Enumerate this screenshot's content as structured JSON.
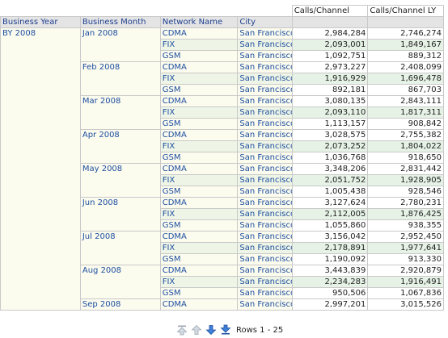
{
  "columns": {
    "business_year": "Business Year",
    "business_month": "Business Month",
    "network_name": "Network Name",
    "city": "City",
    "calls_channel": "Calls/Channel",
    "calls_channel_ly": "Calls/Channel LY"
  },
  "year": "BY 2008",
  "months": [
    {
      "label": "Jan 2008",
      "rows": [
        {
          "network": "CDMA",
          "city": "San Francisco",
          "calls": "2,984,284",
          "calls_ly": "2,746,274"
        },
        {
          "network": "FIX",
          "city": "San Francisco",
          "calls": "2,093,001",
          "calls_ly": "1,849,167"
        },
        {
          "network": "GSM",
          "city": "San Francisco",
          "calls": "1,092,751",
          "calls_ly": "889,312"
        }
      ]
    },
    {
      "label": "Feb 2008",
      "rows": [
        {
          "network": "CDMA",
          "city": "San Francisco",
          "calls": "2,973,227",
          "calls_ly": "2,408,099"
        },
        {
          "network": "FIX",
          "city": "San Francisco",
          "calls": "1,916,929",
          "calls_ly": "1,696,478"
        },
        {
          "network": "GSM",
          "city": "San Francisco",
          "calls": "892,181",
          "calls_ly": "867,703"
        }
      ]
    },
    {
      "label": "Mar 2008",
      "rows": [
        {
          "network": "CDMA",
          "city": "San Francisco",
          "calls": "3,080,135",
          "calls_ly": "2,843,111"
        },
        {
          "network": "FIX",
          "city": "San Francisco",
          "calls": "2,093,110",
          "calls_ly": "1,817,311"
        },
        {
          "network": "GSM",
          "city": "San Francisco",
          "calls": "1,113,157",
          "calls_ly": "908,842"
        }
      ]
    },
    {
      "label": "Apr 2008",
      "rows": [
        {
          "network": "CDMA",
          "city": "San Francisco",
          "calls": "3,028,575",
          "calls_ly": "2,755,382"
        },
        {
          "network": "FIX",
          "city": "San Francisco",
          "calls": "2,073,252",
          "calls_ly": "1,804,022"
        },
        {
          "network": "GSM",
          "city": "San Francisco",
          "calls": "1,036,768",
          "calls_ly": "918,650"
        }
      ]
    },
    {
      "label": "May 2008",
      "rows": [
        {
          "network": "CDMA",
          "city": "San Francisco",
          "calls": "3,348,206",
          "calls_ly": "2,831,442"
        },
        {
          "network": "FIX",
          "city": "San Francisco",
          "calls": "2,051,752",
          "calls_ly": "1,928,905"
        },
        {
          "network": "GSM",
          "city": "San Francisco",
          "calls": "1,005,438",
          "calls_ly": "928,546"
        }
      ]
    },
    {
      "label": "Jun 2008",
      "rows": [
        {
          "network": "CDMA",
          "city": "San Francisco",
          "calls": "3,127,624",
          "calls_ly": "2,780,231"
        },
        {
          "network": "FIX",
          "city": "San Francisco",
          "calls": "2,112,005",
          "calls_ly": "1,876,425"
        },
        {
          "network": "GSM",
          "city": "San Francisco",
          "calls": "1,055,860",
          "calls_ly": "938,355"
        }
      ]
    },
    {
      "label": "Jul 2008",
      "rows": [
        {
          "network": "CDMA",
          "city": "San Francisco",
          "calls": "3,156,042",
          "calls_ly": "2,952,450"
        },
        {
          "network": "FIX",
          "city": "San Francisco",
          "calls": "2,178,891",
          "calls_ly": "1,977,641"
        },
        {
          "network": "GSM",
          "city": "San Francisco",
          "calls": "1,190,092",
          "calls_ly": "913,330"
        }
      ]
    },
    {
      "label": "Aug 2008",
      "rows": [
        {
          "network": "CDMA",
          "city": "San Francisco",
          "calls": "3,443,839",
          "calls_ly": "2,920,879"
        },
        {
          "network": "FIX",
          "city": "San Francisco",
          "calls": "2,234,283",
          "calls_ly": "1,916,491"
        },
        {
          "network": "GSM",
          "city": "San Francisco",
          "calls": "950,506",
          "calls_ly": "1,067,836"
        }
      ]
    },
    {
      "label": "Sep 2008",
      "rows": [
        {
          "network": "CDMA",
          "city": "San Francisco",
          "calls": "2,997,201",
          "calls_ly": "3,015,526"
        }
      ]
    }
  ],
  "pager": {
    "status": "Rows 1 - 25",
    "icons": [
      "page-top-icon",
      "page-up-icon",
      "page-down-icon",
      "page-bottom-icon"
    ]
  },
  "colors": {
    "link": "#1f4fa0",
    "header_bg": "#e4e4e4",
    "row_header_bg": "#fbfbee",
    "alt_row_bg": "#e6f2e6"
  }
}
